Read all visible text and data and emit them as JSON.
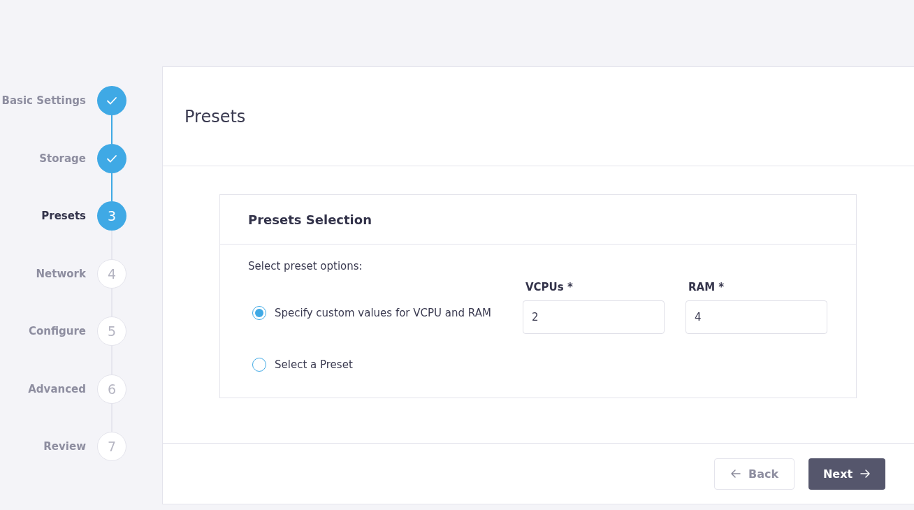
{
  "steps": [
    {
      "label": "Basic Settings",
      "kind": "done"
    },
    {
      "label": "Storage",
      "kind": "done"
    },
    {
      "label": "Presets",
      "kind": "current",
      "number": "3"
    },
    {
      "label": "Network",
      "kind": "todo",
      "number": "4"
    },
    {
      "label": "Configure",
      "kind": "todo",
      "number": "5"
    },
    {
      "label": "Advanced",
      "kind": "todo",
      "number": "6"
    },
    {
      "label": "Review",
      "kind": "todo",
      "number": "7"
    }
  ],
  "page_title": "Presets",
  "section": {
    "title": "Presets Selection",
    "prompt": "Select preset options:",
    "options": [
      {
        "label": "Specify custom values for VCPU and RAM",
        "selected": true
      },
      {
        "label": "Select a Preset",
        "selected": false
      }
    ],
    "fields": [
      {
        "label": "VCPUs *",
        "value": "2"
      },
      {
        "label": "RAM *",
        "value": "4"
      }
    ]
  },
  "buttons": {
    "back": "Back",
    "next": "Next"
  }
}
